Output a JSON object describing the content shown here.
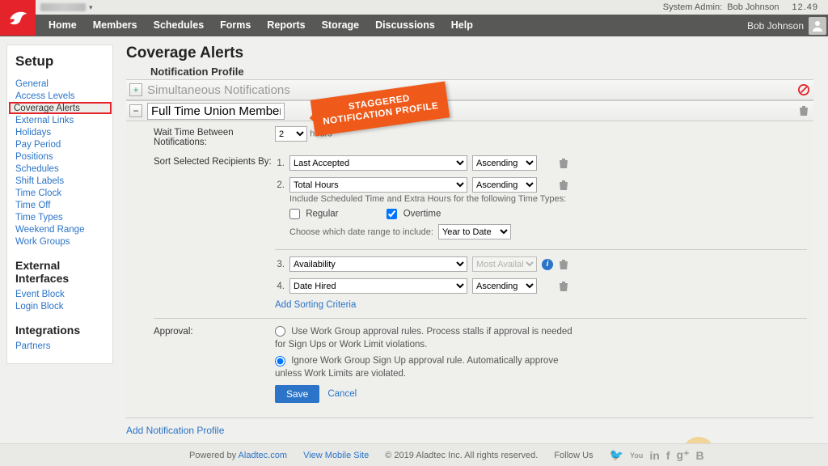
{
  "topbar": {
    "sysadmin_label": "System Admin:",
    "sysadmin_user": "Bob Johnson",
    "time": "12.49"
  },
  "nav": {
    "items": [
      "Home",
      "Members",
      "Schedules",
      "Forms",
      "Reports",
      "Storage",
      "Discussions",
      "Help"
    ],
    "user": "Bob Johnson"
  },
  "sidebar": {
    "title": "Setup",
    "groups": [
      {
        "heading": null,
        "items": [
          "General",
          "Access Levels",
          "Coverage Alerts",
          "External Links",
          "Holidays",
          "Pay Period",
          "Positions",
          "Schedules",
          "Shift Labels",
          "Time Clock",
          "Time Off",
          "Time Types",
          "Weekend Range",
          "Work Groups"
        ],
        "active_index": 2
      },
      {
        "heading": "External Interfaces",
        "items": [
          "Event Block",
          "Login Block"
        ]
      },
      {
        "heading": "Integrations",
        "items": [
          "Partners"
        ]
      }
    ]
  },
  "main": {
    "title": "Coverage Alerts",
    "subtitle": "Notification Profile",
    "callout": "STAGGERED\nNOTIFICATION PROFILE",
    "profile_collapsed": {
      "title": "Simultaneous Notifications"
    },
    "profile_expanded": {
      "title": "Full Time Union Members",
      "wait_label": "Wait Time Between Notifications:",
      "wait_value": "2",
      "wait_unit": "hours",
      "sort_label": "Sort Selected Recipients By:",
      "criteria": [
        {
          "n": "1.",
          "field": "Last Accepted",
          "dir": "Ascending",
          "trash": true
        },
        {
          "n": "2.",
          "field": "Total Hours",
          "dir": "Ascending",
          "trash": true,
          "help1": "Include Scheduled Time and Extra Hours for the following Time Types:",
          "chk_regular": "Regular",
          "chk_regular_v": false,
          "chk_overtime": "Overtime",
          "chk_overtime_v": true,
          "help2": "Choose which date range to include:",
          "range": "Year to Date"
        },
        {
          "n": "3.",
          "field": "Availability",
          "dir": "Most Available",
          "info": true,
          "trash": true,
          "dir_disabled": true
        },
        {
          "n": "4.",
          "field": "Date Hired",
          "dir": "Ascending",
          "trash": true
        }
      ],
      "add_sort": "Add Sorting Criteria",
      "approval_label": "Approval:",
      "approval_opts": [
        "Use Work Group approval rules. Process stalls if approval is needed for Sign Ups or Work Limit violations.",
        "Ignore Work Group Sign Up approval rule. Automatically approve unless Work Limits are violated."
      ],
      "approval_selected": 1,
      "save": "Save",
      "cancel": "Cancel"
    },
    "add_profile": "Add Notification Profile"
  },
  "footer": {
    "powered": "Powered by",
    "powered_link": "Aladtec.com",
    "mobile": "View Mobile Site",
    "copyright": "© 2019 Aladtec Inc. All rights reserved.",
    "follow": "Follow Us"
  }
}
